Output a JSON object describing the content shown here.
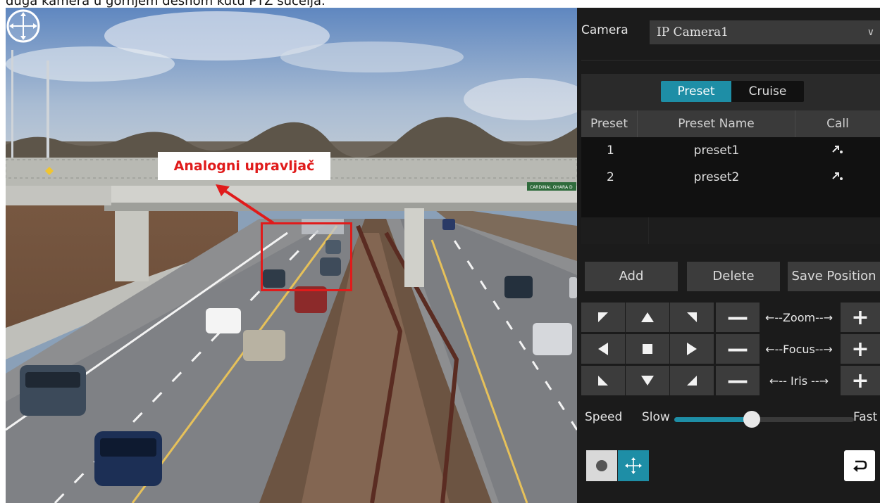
{
  "caption": "duga kamera u gornjem desnom kutu PTZ sučelja.",
  "overlay": {
    "callout_label": "Analogni upravljač",
    "callout_color": "#e01b1b",
    "bridge_sign": "CARDINAL OHARA D"
  },
  "panel": {
    "camera_label": "Camera",
    "camera_value": "IP Camera1",
    "tabs": [
      {
        "label": "Preset",
        "active": true
      },
      {
        "label": "Cruise",
        "active": false
      }
    ],
    "table": {
      "headers": [
        "Preset",
        "Preset Name",
        "Call"
      ],
      "rows": [
        {
          "num": "1",
          "name": "preset1",
          "call_icon": "call-preset-icon"
        },
        {
          "num": "2",
          "name": "preset2",
          "call_icon": "call-preset-icon"
        }
      ]
    },
    "buttons": {
      "add": "Add",
      "delete": "Delete",
      "save_position": "Save Position"
    },
    "ptz": {
      "zoom_label": "←--Zoom--→",
      "focus_label": "←--Focus--→",
      "iris_label": "←-- Iris --→",
      "minus": "—",
      "plus": "+"
    },
    "speed": {
      "label": "Speed",
      "slow": "Slow",
      "fast": "Fast",
      "level": 0.43
    },
    "accent_color": "#1e8ea6"
  }
}
